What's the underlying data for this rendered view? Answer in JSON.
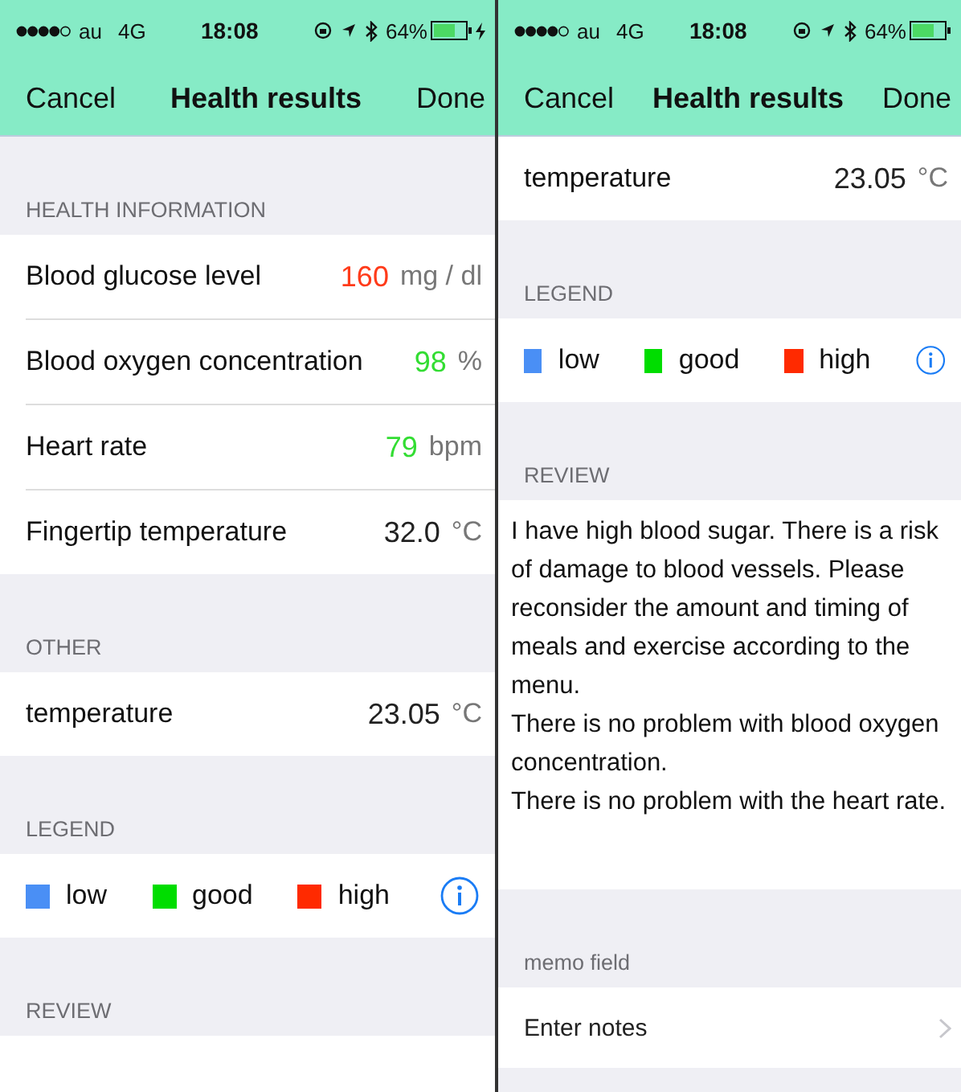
{
  "screens": [
    {
      "status_bar": {
        "carrier": "au",
        "network": "4G",
        "time": "18:08",
        "battery": "64%",
        "charging": true
      },
      "nav": {
        "left": "Cancel",
        "title": "Health results",
        "right": "Done"
      },
      "sections": [
        {
          "kind": "list",
          "header": "HEALTH INFORMATION",
          "rows": [
            {
              "label": "Blood glucose level",
              "value": "160",
              "unit": "mg / dl",
              "color": "#ff3b1a"
            },
            {
              "label": "Blood oxygen concentration",
              "value": "98",
              "unit": "%",
              "color": "#33dd33"
            },
            {
              "label": "Heart rate",
              "value": "79",
              "unit": "bpm",
              "color": "#33dd33"
            },
            {
              "label": "Fingertip temperature",
              "value": "32.0",
              "unit": "°C",
              "color": "#222222"
            }
          ]
        },
        {
          "kind": "list",
          "header": "OTHER",
          "rows": [
            {
              "label": "temperature",
              "value": "23.05",
              "unit": "°C",
              "color": "#222222"
            }
          ]
        },
        {
          "kind": "legend",
          "header": "LEGEND",
          "items": [
            {
              "label": "low",
              "color": "#4a8ff5"
            },
            {
              "label": "good",
              "color": "#00dd00"
            },
            {
              "label": "high",
              "color": "#ff2a00"
            }
          ]
        },
        {
          "kind": "text",
          "header": "REVIEW"
        }
      ]
    },
    {
      "status_bar": {
        "carrier": "au",
        "network": "4G",
        "time": "18:08",
        "battery": "64%"
      },
      "nav": {
        "left": "Cancel",
        "title": "Health results",
        "right": "Done"
      },
      "sections": [
        {
          "kind": "list",
          "rows": [
            {
              "label": "temperature",
              "value": "23.05",
              "unit": "°C",
              "color": "#222222"
            }
          ]
        },
        {
          "kind": "legend",
          "header": "LEGEND",
          "items": [
            {
              "label": "low",
              "color": "#4a8ff5"
            },
            {
              "label": "good",
              "color": "#00dd00"
            },
            {
              "label": "high",
              "color": "#ff2a00"
            }
          ]
        },
        {
          "kind": "text",
          "header": "REVIEW",
          "text": "I have high blood sugar. There is a risk of damage to blood vessels. Please reconsider the amount and timing of meals and exercise according to the menu.\nThere is no problem with blood oxygen concentration.\nThere is no problem with the heart rate."
        },
        {
          "kind": "link",
          "header": "memo field",
          "label": "Enter notes"
        }
      ]
    }
  ]
}
